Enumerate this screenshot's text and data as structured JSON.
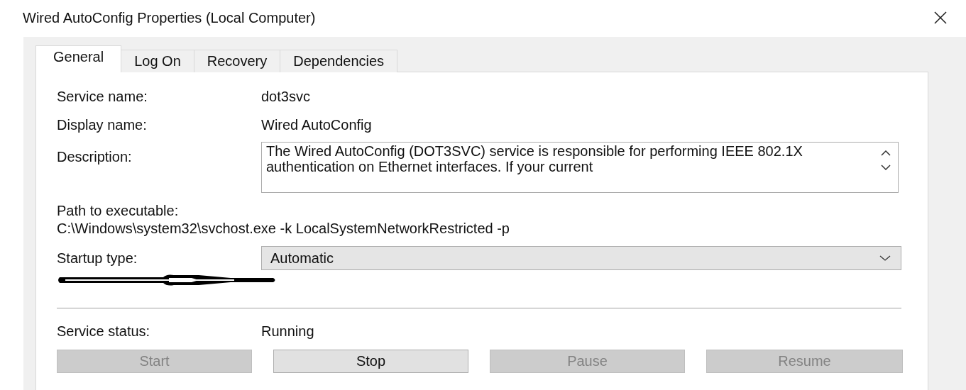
{
  "window": {
    "title": "Wired AutoConfig Properties (Local Computer)"
  },
  "tabs": [
    {
      "label": "General",
      "selected": true
    },
    {
      "label": "Log On",
      "selected": false
    },
    {
      "label": "Recovery",
      "selected": false
    },
    {
      "label": "Dependencies",
      "selected": false
    }
  ],
  "fields": [
    {
      "label": "Service name:",
      "value": "dot3svc"
    },
    {
      "label": "Display name:",
      "value": "Wired AutoConfig"
    }
  ],
  "description": {
    "label": "Description:",
    "value": "The Wired AutoConfig (DOT3SVC) service is responsible for performing IEEE 802.1X authentication on Ethernet interfaces. If your current"
  },
  "path": {
    "label": "Path to executable:",
    "value": "C:\\Windows\\system32\\svchost.exe -k LocalSystemNetworkRestricted -p"
  },
  "startup_type": {
    "label": "Startup type:",
    "value": "Automatic"
  },
  "service_status": {
    "label": "Service status:",
    "value": "Running"
  },
  "buttons": [
    {
      "label": "Start",
      "disabled": true
    },
    {
      "label": "Stop",
      "disabled": false
    },
    {
      "label": "Pause",
      "disabled": true
    },
    {
      "label": "Resume",
      "disabled": true
    }
  ]
}
